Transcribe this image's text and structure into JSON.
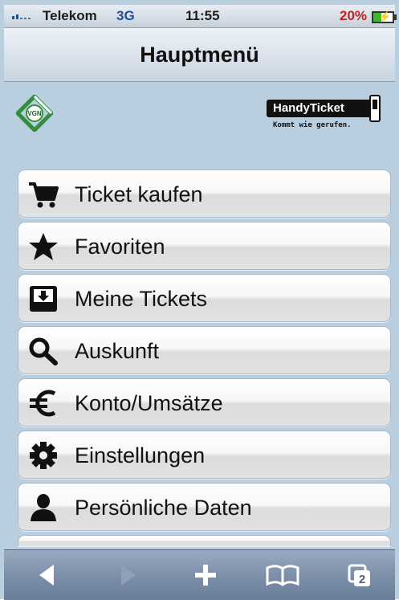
{
  "status_bar": {
    "carrier": "Telekom",
    "network": "3G",
    "time": "11:55",
    "battery": "20%"
  },
  "header": {
    "title": "Hauptmenü"
  },
  "logos": {
    "left_logo_text": "VGN",
    "right_logo_title": "HandyTicket",
    "right_logo_slogan": "Kommt wie gerufen."
  },
  "menu": {
    "items": [
      {
        "label": "Ticket kaufen",
        "icon": "cart-icon"
      },
      {
        "label": "Favoriten",
        "icon": "star-icon"
      },
      {
        "label": "Meine Tickets",
        "icon": "inbox-download-icon"
      },
      {
        "label": "Auskunft",
        "icon": "search-icon"
      },
      {
        "label": "Konto/Umsätze",
        "icon": "euro-icon"
      },
      {
        "label": "Einstellungen",
        "icon": "gear-icon"
      },
      {
        "label": "Persönliche Daten",
        "icon": "person-icon"
      }
    ]
  },
  "toolbar": {
    "tabs_count": "2",
    "icons": [
      "back-icon",
      "forward-icon",
      "add-icon",
      "bookmarks-icon",
      "tabs-icon"
    ]
  },
  "colors": {
    "background": "#b9cfe0",
    "network": "#1f4f94",
    "battery_text": "#c32020",
    "battery_fill": "#3cba2b",
    "toolbar": "#7d90aa"
  }
}
